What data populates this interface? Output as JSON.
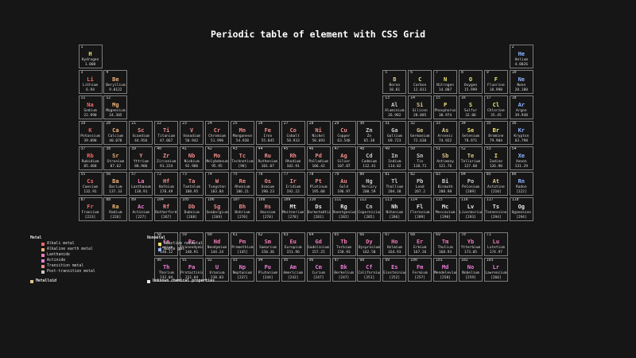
{
  "page": {
    "title": "Periodic table of element with CSS Grid"
  },
  "colors": {
    "alkali": "#f06a6a",
    "alkaline": "#f0b27a",
    "lanthanide": "#f07ab9",
    "actinide": "#ea7cd6",
    "transition": "#ef8b8b",
    "post": "#c9c9c9",
    "metalloid": "#d9c58e",
    "reactive": "#efe36f",
    "noble": "#8fb6ff",
    "unknown": "#e6e6e6"
  },
  "legend": {
    "metal_header": "Metal",
    "metal_items": [
      {
        "label": "Alkali metal",
        "color_key": "alkali"
      },
      {
        "label": "Alkaline earth metal",
        "color_key": "alkaline"
      },
      {
        "label": "Lanthanide",
        "color_key": "lanthanide"
      },
      {
        "label": "Actinide",
        "color_key": "actinide"
      },
      {
        "label": "Transition metal",
        "color_key": "transition"
      },
      {
        "label": "Post-transition metal",
        "color_key": "post"
      }
    ],
    "metalloid": {
      "label": "Metalloid",
      "color_key": "metalloid"
    },
    "nonmetal_header": "Nonmetal",
    "nonmetal_items": [
      {
        "label": "Reactive nonmetal",
        "color_key": "reactive"
      },
      {
        "label": "Noble gas",
        "color_key": "noble"
      }
    ],
    "unknown": {
      "label": "Unknown chemical properties",
      "color_key": "unknown"
    }
  },
  "elements": [
    {
      "n": 1,
      "s": "H",
      "name": "Hydrogen",
      "m": "1.008",
      "c": "reactive",
      "p": 1,
      "g": 1
    },
    {
      "n": 2,
      "s": "He",
      "name": "Helium",
      "m": "4.0026",
      "c": "noble",
      "p": 1,
      "g": 18
    },
    {
      "n": 3,
      "s": "Li",
      "name": "Lithium",
      "m": "6.94",
      "c": "alkali",
      "p": 2,
      "g": 1
    },
    {
      "n": 4,
      "s": "Be",
      "name": "Beryllium",
      "m": "9.0122",
      "c": "alkaline",
      "p": 2,
      "g": 2
    },
    {
      "n": 5,
      "s": "B",
      "name": "Boron",
      "m": "10.81",
      "c": "metalloid",
      "p": 2,
      "g": 13
    },
    {
      "n": 6,
      "s": "C",
      "name": "Carbon",
      "m": "12.011",
      "c": "reactive",
      "p": 2,
      "g": 14
    },
    {
      "n": 7,
      "s": "N",
      "name": "Nitrogen",
      "m": "14.007",
      "c": "reactive",
      "p": 2,
      "g": 15
    },
    {
      "n": 8,
      "s": "O",
      "name": "Oxygen",
      "m": "15.999",
      "c": "reactive",
      "p": 2,
      "g": 16
    },
    {
      "n": 9,
      "s": "F",
      "name": "Fluorine",
      "m": "18.998",
      "c": "reactive",
      "p": 2,
      "g": 17
    },
    {
      "n": 10,
      "s": "Ne",
      "name": "Neon",
      "m": "20.180",
      "c": "noble",
      "p": 2,
      "g": 18
    },
    {
      "n": 11,
      "s": "Na",
      "name": "Sodium",
      "m": "22.990",
      "c": "alkali",
      "p": 3,
      "g": 1
    },
    {
      "n": 12,
      "s": "Mg",
      "name": "Magnesium",
      "m": "24.305",
      "c": "alkaline",
      "p": 3,
      "g": 2
    },
    {
      "n": 13,
      "s": "Al",
      "name": "Aluminium",
      "m": "26.982",
      "c": "post",
      "p": 3,
      "g": 13
    },
    {
      "n": 14,
      "s": "Si",
      "name": "Silicon",
      "m": "28.085",
      "c": "metalloid",
      "p": 3,
      "g": 14
    },
    {
      "n": 15,
      "s": "P",
      "name": "Phosphorus",
      "m": "30.974",
      "c": "reactive",
      "p": 3,
      "g": 15
    },
    {
      "n": 16,
      "s": "S",
      "name": "Sulfur",
      "m": "32.06",
      "c": "reactive",
      "p": 3,
      "g": 16
    },
    {
      "n": 17,
      "s": "Cl",
      "name": "Chlorine",
      "m": "35.45",
      "c": "reactive",
      "p": 3,
      "g": 17
    },
    {
      "n": 18,
      "s": "Ar",
      "name": "Argon",
      "m": "39.948",
      "c": "noble",
      "p": 3,
      "g": 18
    },
    {
      "n": 19,
      "s": "K",
      "name": "Potassium",
      "m": "39.098",
      "c": "alkali",
      "p": 4,
      "g": 1
    },
    {
      "n": 20,
      "s": "Ca",
      "name": "Calcium",
      "m": "40.078",
      "c": "alkaline",
      "p": 4,
      "g": 2
    },
    {
      "n": 21,
      "s": "Sc",
      "name": "Scandium",
      "m": "44.956",
      "c": "transition",
      "p": 4,
      "g": 3
    },
    {
      "n": 22,
      "s": "Ti",
      "name": "Titanium",
      "m": "47.867",
      "c": "transition",
      "p": 4,
      "g": 4
    },
    {
      "n": 23,
      "s": "V",
      "name": "Vanadium",
      "m": "50.942",
      "c": "transition",
      "p": 4,
      "g": 5
    },
    {
      "n": 24,
      "s": "Cr",
      "name": "Chromium",
      "m": "51.996",
      "c": "transition",
      "p": 4,
      "g": 6
    },
    {
      "n": 25,
      "s": "Mn",
      "name": "Manganese",
      "m": "54.938",
      "c": "transition",
      "p": 4,
      "g": 7
    },
    {
      "n": 26,
      "s": "Fe",
      "name": "Iron",
      "m": "55.845",
      "c": "transition",
      "p": 4,
      "g": 8
    },
    {
      "n": 27,
      "s": "Co",
      "name": "Cobalt",
      "m": "58.933",
      "c": "transition",
      "p": 4,
      "g": 9
    },
    {
      "n": 28,
      "s": "Ni",
      "name": "Nickel",
      "m": "58.693",
      "c": "transition",
      "p": 4,
      "g": 10
    },
    {
      "n": 29,
      "s": "Cu",
      "name": "Copper",
      "m": "63.546",
      "c": "transition",
      "p": 4,
      "g": 11
    },
    {
      "n": 30,
      "s": "Zn",
      "name": "Zn",
      "m": "65.38",
      "c": "post",
      "p": 4,
      "g": 12
    },
    {
      "n": 31,
      "s": "Ga",
      "name": "Gallium",
      "m": "69.723",
      "c": "post",
      "p": 4,
      "g": 13
    },
    {
      "n": 32,
      "s": "Ge",
      "name": "Germanium",
      "m": "72.630",
      "c": "metalloid",
      "p": 4,
      "g": 14
    },
    {
      "n": 33,
      "s": "As",
      "name": "Arsenic",
      "m": "74.922",
      "c": "metalloid",
      "p": 4,
      "g": 15
    },
    {
      "n": 34,
      "s": "Se",
      "name": "Selenium",
      "m": "78.971",
      "c": "reactive",
      "p": 4,
      "g": 16
    },
    {
      "n": 35,
      "s": "Br",
      "name": "Bromine",
      "m": "79.904",
      "c": "reactive",
      "p": 4,
      "g": 17
    },
    {
      "n": 36,
      "s": "Kr",
      "name": "Krypton",
      "m": "83.798",
      "c": "noble",
      "p": 4,
      "g": 18
    },
    {
      "n": 37,
      "s": "Rb",
      "name": "Rubidium",
      "m": "85.468",
      "c": "alkali",
      "p": 5,
      "g": 1
    },
    {
      "n": 38,
      "s": "Sr",
      "name": "Stronium",
      "m": "87.62",
      "c": "alkaline",
      "p": 5,
      "g": 2
    },
    {
      "n": 39,
      "s": "Y",
      "name": "Yttrium",
      "m": "88.906",
      "c": "transition",
      "p": 5,
      "g": 3
    },
    {
      "n": 40,
      "s": "Zr",
      "name": "Zirconium",
      "m": "91.224",
      "c": "transition",
      "p": 5,
      "g": 4
    },
    {
      "n": 41,
      "s": "Nb",
      "name": "Niobium",
      "m": "92.906",
      "c": "transition",
      "p": 5,
      "g": 5
    },
    {
      "n": 42,
      "s": "Mo",
      "name": "Molybdenum",
      "m": "95.95",
      "c": "transition",
      "p": 5,
      "g": 6
    },
    {
      "n": 43,
      "s": "Tc",
      "name": "Technetium",
      "m": "[98]",
      "c": "transition",
      "p": 5,
      "g": 7
    },
    {
      "n": 44,
      "s": "Ru",
      "name": "Ruthenium",
      "m": "101.07",
      "c": "transition",
      "p": 5,
      "g": 8
    },
    {
      "n": 45,
      "s": "Rh",
      "name": "Rhodium",
      "m": "102.91",
      "c": "transition",
      "p": 5,
      "g": 9
    },
    {
      "n": 46,
      "s": "Pd",
      "name": "Palladium",
      "m": "106.42",
      "c": "transition",
      "p": 5,
      "g": 10
    },
    {
      "n": 47,
      "s": "Ag",
      "name": "Silver",
      "m": "107.87",
      "c": "transition",
      "p": 5,
      "g": 11
    },
    {
      "n": 48,
      "s": "Cd",
      "name": "Cadmium",
      "m": "112.41",
      "c": "post",
      "p": 5,
      "g": 12
    },
    {
      "n": 49,
      "s": "In",
      "name": "Indium",
      "m": "114.82",
      "c": "post",
      "p": 5,
      "g": 13
    },
    {
      "n": 50,
      "s": "Sn",
      "name": "Tin",
      "m": "118.71",
      "c": "post",
      "p": 5,
      "g": 14
    },
    {
      "n": 51,
      "s": "Sb",
      "name": "Antimony",
      "m": "121.76",
      "c": "metalloid",
      "p": 5,
      "g": 15
    },
    {
      "n": 52,
      "s": "Te",
      "name": "Tellurium",
      "m": "127.60",
      "c": "metalloid",
      "p": 5,
      "g": 16
    },
    {
      "n": 53,
      "s": "I",
      "name": "Iodine",
      "m": "126.90",
      "c": "reactive",
      "p": 5,
      "g": 17
    },
    {
      "n": 54,
      "s": "Xe",
      "name": "Xenon",
      "m": "131.29",
      "c": "noble",
      "p": 5,
      "g": 18
    },
    {
      "n": 55,
      "s": "Cs",
      "name": "Caesium",
      "m": "132.91",
      "c": "alkali",
      "p": 6,
      "g": 1
    },
    {
      "n": 56,
      "s": "Ba",
      "name": "Barium",
      "m": "137.33",
      "c": "alkaline",
      "p": 6,
      "g": 2
    },
    {
      "n": 57,
      "s": "La",
      "name": "Lanthanum",
      "m": "138.91",
      "c": "lanthanide",
      "p": 6,
      "g": 3
    },
    {
      "n": 72,
      "s": "Hf",
      "name": "Hafnium",
      "m": "178.49",
      "c": "transition",
      "p": 6,
      "g": 4
    },
    {
      "n": 73,
      "s": "Ta",
      "name": "Tantalum",
      "m": "180.95",
      "c": "transition",
      "p": 6,
      "g": 5
    },
    {
      "n": 74,
      "s": "W",
      "name": "Tungsten",
      "m": "183.84",
      "c": "transition",
      "p": 6,
      "g": 6
    },
    {
      "n": 75,
      "s": "Re",
      "name": "Rhenium",
      "m": "186.21",
      "c": "transition",
      "p": 6,
      "g": 7
    },
    {
      "n": 76,
      "s": "Os",
      "name": "Osmium",
      "m": "190.23",
      "c": "transition",
      "p": 6,
      "g": 8
    },
    {
      "n": 77,
      "s": "Ir",
      "name": "Iridium",
      "m": "192.22",
      "c": "transition",
      "p": 6,
      "g": 9
    },
    {
      "n": 78,
      "s": "Pt",
      "name": "Platinum",
      "m": "195.08",
      "c": "transition",
      "p": 6,
      "g": 10
    },
    {
      "n": 79,
      "s": "Au",
      "name": "Gold",
      "m": "196.97",
      "c": "transition",
      "p": 6,
      "g": 11
    },
    {
      "n": 80,
      "s": "Hg",
      "name": "Mercury",
      "m": "200.59",
      "c": "post",
      "p": 6,
      "g": 12
    },
    {
      "n": 81,
      "s": "Tl",
      "name": "Thallium",
      "m": "204.38",
      "c": "post",
      "p": 6,
      "g": 13
    },
    {
      "n": 82,
      "s": "Pb",
      "name": "Lead",
      "m": "207.2",
      "c": "post",
      "p": 6,
      "g": 14
    },
    {
      "n": 83,
      "s": "Bi",
      "name": "Bismuth",
      "m": "208.98",
      "c": "post",
      "p": 6,
      "g": 15
    },
    {
      "n": 84,
      "s": "Po",
      "name": "Polonium",
      "m": "[209]",
      "c": "post",
      "p": 6,
      "g": 16
    },
    {
      "n": 85,
      "s": "At",
      "name": "Astatine",
      "m": "[210]",
      "c": "metalloid",
      "p": 6,
      "g": 17
    },
    {
      "n": 86,
      "s": "Rn",
      "name": "Radon",
      "m": "[222]",
      "c": "noble",
      "p": 6,
      "g": 18
    },
    {
      "n": 87,
      "s": "Fr",
      "name": "Francium",
      "m": "[223]",
      "c": "alkali",
      "p": 7,
      "g": 1
    },
    {
      "n": 88,
      "s": "Ra",
      "name": "Radium",
      "m": "[226]",
      "c": "alkaline",
      "p": 7,
      "g": 2
    },
    {
      "n": 89,
      "s": "Ac",
      "name": "Actinium",
      "m": "[227]",
      "c": "actinide",
      "p": 7,
      "g": 3
    },
    {
      "n": 104,
      "s": "Rf",
      "name": "Rutherfordium",
      "m": "[267]",
      "c": "transition",
      "p": 7,
      "g": 4
    },
    {
      "n": 105,
      "s": "Db",
      "name": "Dubnium",
      "m": "[268]",
      "c": "transition",
      "p": 7,
      "g": 5
    },
    {
      "n": 106,
      "s": "Sg",
      "name": "Seaborgium",
      "m": "[269]",
      "c": "transition",
      "p": 7,
      "g": 6
    },
    {
      "n": 107,
      "s": "Bh",
      "name": "Bohrium",
      "m": "[270]",
      "c": "transition",
      "p": 7,
      "g": 7
    },
    {
      "n": 108,
      "s": "Hs",
      "name": "Hassium",
      "m": "[270]",
      "c": "transition",
      "p": 7,
      "g": 8
    },
    {
      "n": 109,
      "s": "Mt",
      "name": "Meitnerium",
      "m": "[278]",
      "c": "unknown",
      "p": 7,
      "g": 9
    },
    {
      "n": 110,
      "s": "Ds",
      "name": "Darmstadtium",
      "m": "[281]",
      "c": "unknown",
      "p": 7,
      "g": 10
    },
    {
      "n": 111,
      "s": "Rg",
      "name": "Roentgenium",
      "m": "[282]",
      "c": "unknown",
      "p": 7,
      "g": 11
    },
    {
      "n": 112,
      "s": "Cn",
      "name": "Copernicium",
      "m": "[285]",
      "c": "post",
      "p": 7,
      "g": 12
    },
    {
      "n": 113,
      "s": "Nh",
      "name": "Nihonium",
      "m": "[286]",
      "c": "unknown",
      "p": 7,
      "g": 13
    },
    {
      "n": 114,
      "s": "Fl",
      "name": "Flerovium",
      "m": "[289]",
      "c": "unknown",
      "p": 7,
      "g": 14
    },
    {
      "n": 115,
      "s": "Mc",
      "name": "Moscovium",
      "m": "[290]",
      "c": "unknown",
      "p": 7,
      "g": 15
    },
    {
      "n": 116,
      "s": "Lv",
      "name": "Livermorium",
      "m": "[293]",
      "c": "unknown",
      "p": 7,
      "g": 16
    },
    {
      "n": 117,
      "s": "Ts",
      "name": "Tennessine",
      "m": "[294]",
      "c": "unknown",
      "p": 7,
      "g": 17
    },
    {
      "n": 118,
      "s": "Og",
      "name": "Oganesson",
      "m": "[294]",
      "c": "unknown",
      "p": 7,
      "g": 18
    },
    {
      "n": 58,
      "s": "Ce",
      "name": "Cerium",
      "m": "140.12",
      "c": "lanthanide",
      "p": 9,
      "g": 4
    },
    {
      "n": 59,
      "s": "Pr",
      "name": "Praseodymium",
      "m": "140.91",
      "c": "lanthanide",
      "p": 9,
      "g": 5
    },
    {
      "n": 60,
      "s": "Nd",
      "name": "Neodymium",
      "m": "144.24",
      "c": "lanthanide",
      "p": 9,
      "g": 6
    },
    {
      "n": 61,
      "s": "Pm",
      "name": "Promethium",
      "m": "[145]",
      "c": "lanthanide",
      "p": 9,
      "g": 7
    },
    {
      "n": 62,
      "s": "Sm",
      "name": "Samarium",
      "m": "150.36",
      "c": "lanthanide",
      "p": 9,
      "g": 8
    },
    {
      "n": 63,
      "s": "Eu",
      "name": "Europium",
      "m": "151.96",
      "c": "lanthanide",
      "p": 9,
      "g": 9
    },
    {
      "n": 64,
      "s": "Gd",
      "name": "Gadolinium",
      "m": "157.25",
      "c": "lanthanide",
      "p": 9,
      "g": 10
    },
    {
      "n": 65,
      "s": "Tb",
      "name": "Terbium",
      "m": "158.93",
      "c": "lanthanide",
      "p": 9,
      "g": 11
    },
    {
      "n": 66,
      "s": "Dy",
      "name": "Dysprosium",
      "m": "162.50",
      "c": "lanthanide",
      "p": 9,
      "g": 12
    },
    {
      "n": 67,
      "s": "Ho",
      "name": "Holmium",
      "m": "164.93",
      "c": "lanthanide",
      "p": 9,
      "g": 13
    },
    {
      "n": 68,
      "s": "Er",
      "name": "Erbium",
      "m": "167.26",
      "c": "lanthanide",
      "p": 9,
      "g": 14
    },
    {
      "n": 69,
      "s": "Tm",
      "name": "Thulium",
      "m": "168.93",
      "c": "lanthanide",
      "p": 9,
      "g": 15
    },
    {
      "n": 70,
      "s": "Yb",
      "name": "Ytterbium",
      "m": "173.05",
      "c": "lanthanide",
      "p": 9,
      "g": 16
    },
    {
      "n": 71,
      "s": "Lu",
      "name": "Lutetium",
      "m": "174.97",
      "c": "lanthanide",
      "p": 9,
      "g": 17
    },
    {
      "n": 90,
      "s": "Th",
      "name": "Thorium",
      "m": "232.04",
      "c": "actinide",
      "p": 10,
      "g": 4
    },
    {
      "n": 91,
      "s": "Pa",
      "name": "Protactinium",
      "m": "231.04",
      "c": "actinide",
      "p": 10,
      "g": 5
    },
    {
      "n": 92,
      "s": "U",
      "name": "Uranium",
      "m": "238.03",
      "c": "actinide",
      "p": 10,
      "g": 6
    },
    {
      "n": 93,
      "s": "Np",
      "name": "Neptunium",
      "m": "[237]",
      "c": "actinide",
      "p": 10,
      "g": 7
    },
    {
      "n": 94,
      "s": "Pu",
      "name": "Plutonium",
      "m": "[244]",
      "c": "actinide",
      "p": 10,
      "g": 8
    },
    {
      "n": 95,
      "s": "Am",
      "name": "Americium",
      "m": "[243]",
      "c": "actinide",
      "p": 10,
      "g": 9
    },
    {
      "n": 96,
      "s": "Cm",
      "name": "Curium",
      "m": "[247]",
      "c": "actinide",
      "p": 10,
      "g": 10
    },
    {
      "n": 97,
      "s": "Bk",
      "name": "Berkelium",
      "m": "[247]",
      "c": "actinide",
      "p": 10,
      "g": 11
    },
    {
      "n": 98,
      "s": "Cf",
      "name": "Californium",
      "m": "[251]",
      "c": "actinide",
      "p": 10,
      "g": 12
    },
    {
      "n": 99,
      "s": "Es",
      "name": "Einsteinium",
      "m": "[252]",
      "c": "actinide",
      "p": 10,
      "g": 13
    },
    {
      "n": 100,
      "s": "Fm",
      "name": "Fermium",
      "m": "[257]",
      "c": "actinide",
      "p": 10,
      "g": 14
    },
    {
      "n": 101,
      "s": "Md",
      "name": "Mendelevium",
      "m": "[258]",
      "c": "actinide",
      "p": 10,
      "g": 15
    },
    {
      "n": 102,
      "s": "No",
      "name": "Nobelium",
      "m": "[259]",
      "c": "actinide",
      "p": 10,
      "g": 16
    },
    {
      "n": 103,
      "s": "Lr",
      "name": "Lawrencium",
      "m": "[266]",
      "c": "actinide",
      "p": 10,
      "g": 17
    }
  ]
}
